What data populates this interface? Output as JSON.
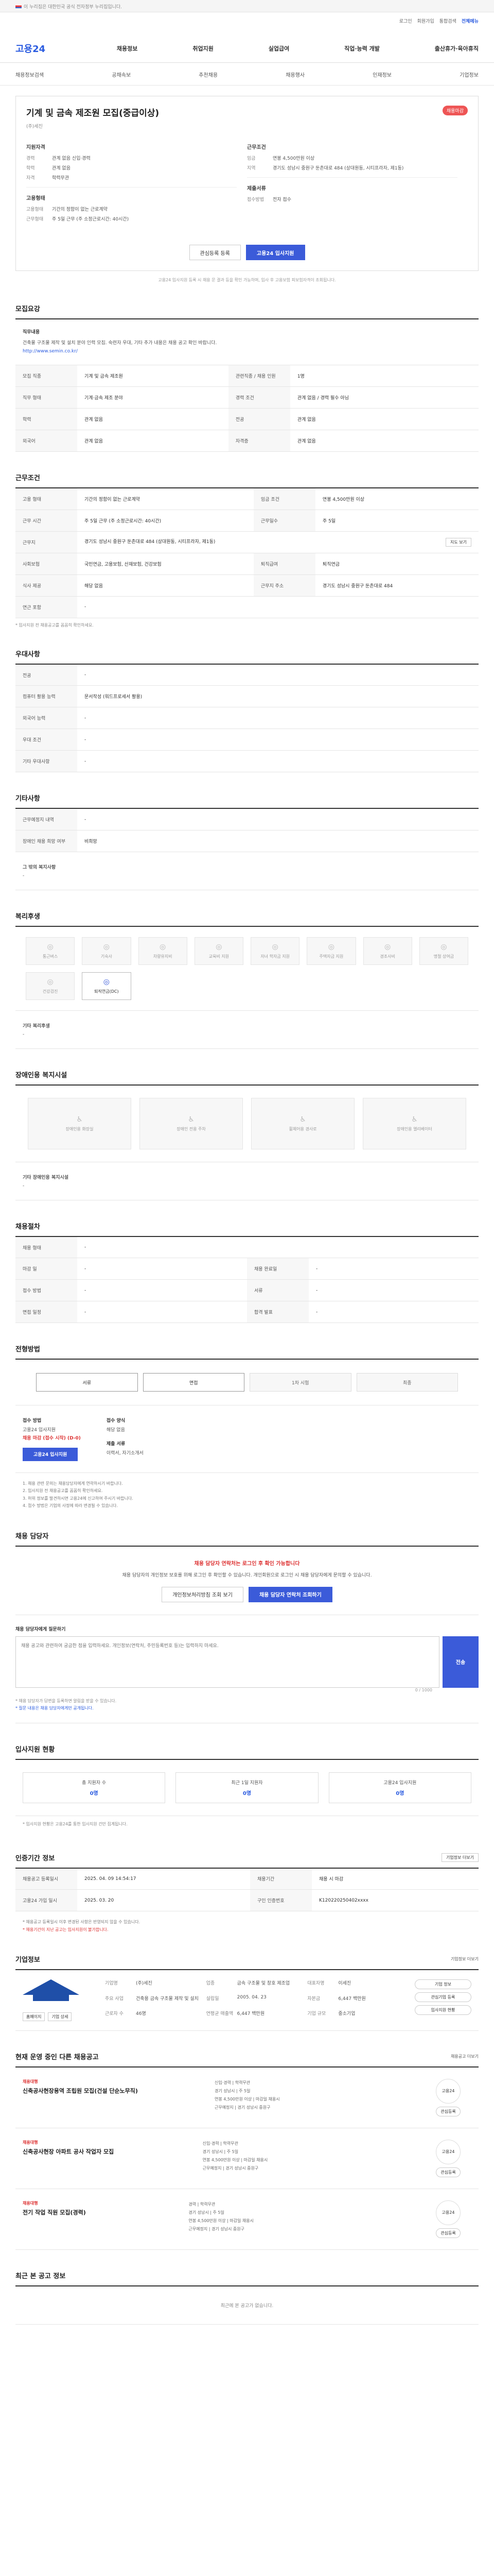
{
  "topbar": {
    "gov_text": "이 누리집은 대한민국 공식 전자정부 누리집입니다."
  },
  "util": {
    "items": [
      "로그인",
      "회원가입",
      "통합검색",
      "전체메뉴"
    ]
  },
  "gnb": {
    "logo": "고용24",
    "menu": [
      "채용정보",
      "취업지원",
      "실업급여",
      "직업·능력 개발",
      "출산휴가·육아휴직"
    ]
  },
  "subnav": {
    "items": [
      "채용정보검색",
      "공채속보",
      "추천채용",
      "채용행사",
      "인재정보",
      "기업정보"
    ]
  },
  "job": {
    "title": "기계 및 금속 제조원 모집(중급이상)",
    "badge": "채용마감",
    "company": "(주)세진",
    "req_head": "지원자격",
    "req": [
      [
        "경력",
        "관계 없음 신입·경력"
      ],
      [
        "학력",
        "관계 없음"
      ],
      [
        "자격",
        "학력무관"
      ]
    ],
    "cond_head": "근무조건",
    "cond": [
      [
        "임금",
        "연봉 4,500만원 이상"
      ],
      [
        "지역",
        "경기도 성남시 중원구 둔촌대로 484 (상대원동, 시티프라자, 제1동)"
      ]
    ],
    "work_head": "고용형태",
    "work": [
      [
        "고용형태",
        "기간의 정함이 없는 근로계약"
      ],
      [
        "근무형태",
        "주 5일 근무 (주 소정근로시간: 40시간)"
      ]
    ],
    "method_head": "제출서류",
    "method": [
      [
        "접수방법",
        "전자 접수"
      ]
    ],
    "btn_save": "관심등록 등록",
    "btn_apply": "고용24 입사지원",
    "notice": "고용24 입사지원 등록 시 채용 문 결과 등을 확인 가능하며, 입사 후 고용보험 피보험자격이 조회됩니다."
  },
  "recruit": {
    "title": "모집요강",
    "desc_head": "직무내용",
    "desc": "건축물 구조물 제작 및 설치 분야 인력 모집. 숙련자 우대, 기타 추가 내용은 채용 공고 확인 바랍니다.",
    "url": "http://www.semin.co.kr/",
    "rows": [
      [
        "모집 직종",
        "기계 및 금속 제조원",
        "관련직종 / 채용 인원",
        "1명"
      ],
      [
        "직무 형태",
        "기계·금속 제조 분야",
        "경력 조건",
        "관계 없음 / 경력 필수 아님"
      ],
      [
        "학력",
        "관계 없음",
        "전공",
        "관계 없음"
      ],
      [
        "외국어",
        "관계 없음",
        "자격증",
        "관계 없음"
      ]
    ]
  },
  "condition": {
    "title": "근무조건",
    "rows": [
      [
        "고용 형태",
        "기간의 정함이 없는 근로계약",
        "임금 조건",
        "연봉 4,500만원 이상"
      ],
      [
        "근무 시간",
        "주 5일 근무 (주 소정근로시간: 40시간)",
        "근무일수",
        "주 5일"
      ],
      [
        "근무지",
        "경기도 성남시 중원구 둔촌대로 484 (상대원동, 시티프라자, 제1동)",
        "근무 예정지",
        ""
      ],
      [
        "사회보험",
        "국민연금, 고용보험, 산재보험, 건강보험",
        "퇴직급여",
        "퇴직연금"
      ],
      [
        "식사 제공",
        "해당 없음",
        "근무지 주소",
        "경기도 성남시 중원구 둔촌대로 484"
      ],
      [
        "연근 포함",
        "-",
        "",
        ""
      ]
    ],
    "map_btn": "지도 보기",
    "tip": "* 입사지원 전 채용공고를 꼼꼼히 확인하세요."
  },
  "treat": {
    "title": "우대사항",
    "rows": [
      [
        "전공",
        "-"
      ],
      [
        "컴퓨터 활용 능력",
        "문서작성 (워드프로세서 활용)"
      ],
      [
        "외국어 능력",
        "-"
      ],
      [
        "우대 조건",
        "-"
      ],
      [
        "기타 우대사항",
        "-"
      ]
    ]
  },
  "etc": {
    "title": "기타사항",
    "rows": [
      [
        "근무예정지 내역",
        "-"
      ],
      [
        "장애인 채용 희망 여부",
        "비희망"
      ]
    ],
    "sub_head": "그 밖의 복지사항",
    "sub_val": "-"
  },
  "welfare": {
    "title": "복리후생",
    "items": [
      "통근버스",
      "기숙사",
      "차량유지비",
      "교육비 지원",
      "자녀 학자금 지원",
      "주택자금 지원",
      "경조사비",
      "명절 상여금",
      "건강검진",
      "퇴직연금(DC)"
    ],
    "on_index": 9,
    "extra_head": "기타 복리후생",
    "extra_val": "-"
  },
  "disabled": {
    "title": "장애인용 복지시설",
    "items": [
      "장애인용 화장실",
      "장애인 전용 주차",
      "휠체어용 경사로",
      "장애인용 엘리베이터"
    ],
    "extra_head": "기타 장애인용 복지시설",
    "extra_val": "-"
  },
  "cond2": {
    "title": "채용절차",
    "rows": [
      [
        "채용 형태",
        "-",
        "",
        ""
      ],
      [
        "마감 일",
        "-",
        "채용 완료일",
        "-"
      ],
      [
        "접수 방법",
        "-",
        "서류",
        "-"
      ],
      [
        "면접 일정",
        "-",
        "합격 발표",
        "-"
      ]
    ]
  },
  "apply": {
    "title": "전형방법",
    "steps": [
      "서류",
      "면접",
      "1차 시험",
      "최종"
    ],
    "on_steps": [
      0,
      1
    ],
    "method_lbl": "접수 방법",
    "method_val": "고용24 입사지원",
    "method_red": "채용 마감 (접수 시작) (D-0)",
    "method_btn": "고용24 입사지원",
    "docs_lbl": "접수 양식",
    "docs_val": "해당 없음",
    "submit_lbl": "제출 서류",
    "submit_val": "이력서, 자기소개서",
    "notes": [
      "1. 채용 관련 문의는 채용담당자에게 연락하시기 바랍니다.",
      "2. 입사지원 전 채용공고를 꼼꼼히 확인하세요.",
      "3. 허위 정보를 발견하시면 고용24에 신고하여 주시기 바랍니다.",
      "4. 접수 방법은 기업의 사정에 따라 변경될 수 있습니다."
    ]
  },
  "contact": {
    "title": "채용 담당자",
    "warn": "채용 담당자 연락처는 로그인 후 확인 가능합니다",
    "desc": "채용 담당자의 개인정보 보호를 위해 로그인 후 확인할 수 있습니다. 개인회원으로 로그인 시 채용 담당자에게 문의할 수 있습니다.",
    "btn1": "개인정보처리방침 조회 보기",
    "btn2": "채용 담당자 연락처 조회하기",
    "q_head": "채용 담당자에게 질문하기",
    "q_placeholder": "채용 공고와 관련하여 궁금한 점을 입력하세요. 개인정보(연락처, 주민등록번호 등)는 입력하지 마세요.",
    "q_send": "전송",
    "counter": "0 / 1000",
    "qnotes": [
      "* 채용 담당자가 답변을 등록하면 알림을 받을 수 있습니다.",
      "* 질문 내용은 채용 담당자에게만 공개됩니다."
    ]
  },
  "stats": {
    "title": "입사지원 현황",
    "items": [
      [
        "총 지원자 수",
        "0명"
      ],
      [
        "최근 1일 지원자",
        "0명"
      ],
      [
        "고용24 입사지원",
        "0명"
      ]
    ],
    "note": "* 입사지원 현황은 고용24를 통한 입사지원 건만 집계됩니다."
  },
  "period": {
    "title": "인증기간 정보",
    "btn": "기업정보 더보기",
    "rows": [
      [
        "채용공고 등록일시",
        "2025. 04. 09 14:54:17",
        "채용기간",
        "채용 시 마감"
      ],
      [
        "고용24 가입 일시",
        "2025. 03. 20",
        "구인 인증번호",
        "K120220250402xxxx"
      ]
    ],
    "notes": [
      "* 채용공고 등록일시 이후 변경된 사항은 반영되지 않을 수 있습니다.",
      "* 채용기간이 지난 공고는 입사지원이 불가합니다."
    ]
  },
  "corp": {
    "title": "기업정보",
    "more": "기업정보 더보기",
    "links": [
      "홈페이지",
      "기업 상세"
    ],
    "info": [
      [
        "기업명",
        "(주)세진"
      ],
      [
        "업종",
        "금속 구조물 및 창호 제조업"
      ],
      [
        "대표자명",
        "이세진"
      ],
      [
        "주요 사업",
        "건축용 금속 구조물 제작 및 설치"
      ],
      [
        "설립일",
        "2005. 04. 23"
      ],
      [
        "자본금",
        "6,447 백만원"
      ],
      [
        "근로자 수",
        "46명"
      ],
      [
        "연평균 매출액",
        "6,447 백만원"
      ],
      [
        "기업 규모",
        "중소기업"
      ]
    ],
    "side": [
      "기업 정보",
      "관심기업 등록",
      "입사지원 현황"
    ]
  },
  "related": {
    "title": "현재 운영 중인 다른 채용공고",
    "more": "채용공고 더보기",
    "jobs": [
      {
        "co": "채용대행",
        "title": "신축공사현장용역 조립원 모집(건설 단순노무직)",
        "meta": [
          "신입·경력 | 학력무관",
          "경기 성남시 | 주 5일",
          "연봉 4,500만원 이상 | 마감일 채용시",
          "근무예정지 | 경기 성남시 중원구"
        ],
        "emb": "고용24",
        "bk": "관심등록"
      },
      {
        "co": "채용대행",
        "title": "신축공사현장 아파트 공사 작업자 모집",
        "meta": [
          "신입·경력 | 학력무관",
          "경기 성남시 | 주 5일",
          "연봉 4,500만원 이상 | 마감일 채용시",
          "근무예정지 | 경기 성남시 중원구"
        ],
        "emb": "고용24",
        "bk": "관심등록"
      },
      {
        "co": "채용대행",
        "title": "전기 작업 직원 모집(경력)",
        "meta": [
          "경력 | 학력무관",
          "경기 성남시 | 주 5일",
          "연봉 4,500만원 이상 | 마감일 채용시",
          "근무예정지 | 경기 성남시 중원구"
        ],
        "emb": "고용24",
        "bk": "관심등록"
      }
    ]
  },
  "viewed": {
    "title": "최근 본 공고 정보",
    "empty": "최근에 본 공고가 없습니다."
  }
}
